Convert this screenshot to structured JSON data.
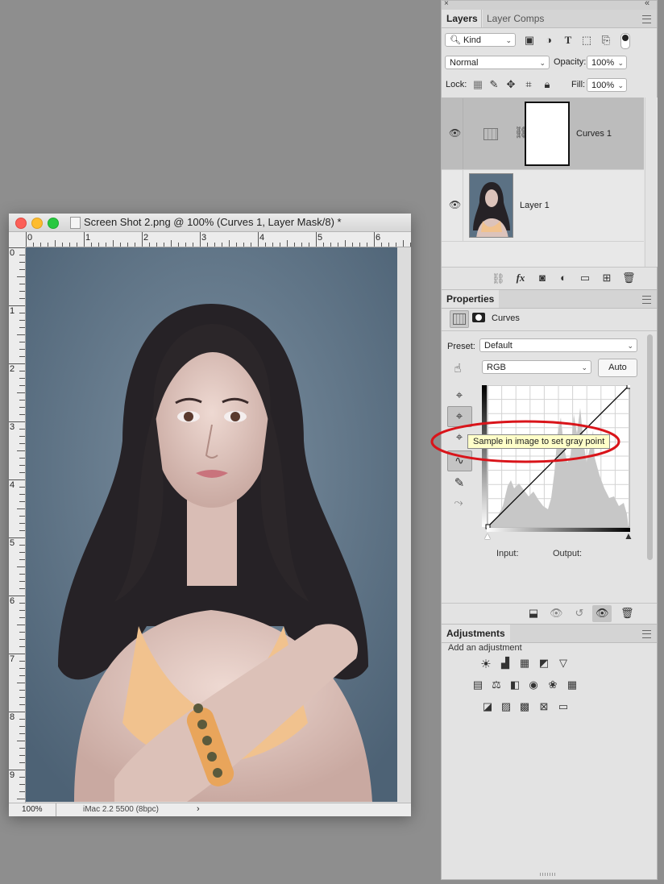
{
  "document": {
    "title": "Screen Shot 2.png @ 100% (Curves 1, Layer Mask/8) *",
    "zoom": "100%",
    "profile": "iMac 2.2 5500 (8bpc)",
    "ruler_h": [
      "0",
      "1",
      "2",
      "3",
      "4",
      "5",
      "6"
    ],
    "ruler_v": [
      "0",
      "1",
      "2",
      "3",
      "4",
      "5",
      "6",
      "7",
      "8",
      "9"
    ]
  },
  "layers_panel": {
    "tabs": [
      "Layers",
      "Layer Comps"
    ],
    "filter_kind": "Kind",
    "blend_mode": "Normal",
    "opacity_label": "Opacity:",
    "opacity_value": "100%",
    "lock_label": "Lock:",
    "fill_label": "Fill:",
    "fill_value": "100%",
    "layers": [
      {
        "name": "Curves 1",
        "selected": true
      },
      {
        "name": "Layer 1",
        "selected": false
      }
    ]
  },
  "properties_panel": {
    "title": "Properties",
    "type_label": "Curves",
    "preset_label": "Preset:",
    "preset_value": "Default",
    "channel_value": "RGB",
    "auto_label": "Auto",
    "input_label": "Input:",
    "output_label": "Output:",
    "tooltip": "Sample in image to set gray point"
  },
  "adjustments_panel": {
    "title": "Adjustments",
    "subtitle": "Add an adjustment"
  },
  "colors": {
    "annotation_ellipse": "#d9141a",
    "canvas_bg": "#5b7184",
    "selected_row": "#bcbcbc"
  }
}
